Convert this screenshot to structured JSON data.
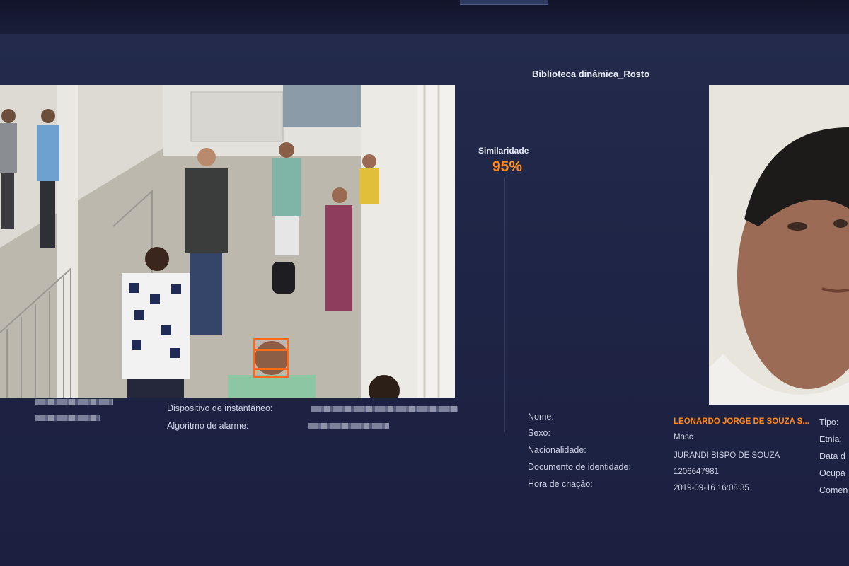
{
  "library": {
    "title": "Biblioteca dinâmica_Rosto"
  },
  "match": {
    "similarity_label": "Similaridade",
    "similarity_value": "95%"
  },
  "snapshot": {
    "device_label": "Dispositivo de instantâneo:",
    "algorithm_label": "Algoritmo de alarme:"
  },
  "person": {
    "labels": {
      "name": "Nome:",
      "sex": "Sexo:",
      "nationality": "Nacionalidade:",
      "id_document": "Documento de identidade:",
      "created": "Hora de criação:"
    },
    "values": {
      "name": "LEONARDO JORGE DE SOUZA S...",
      "sex": "Masc",
      "nationality": "JURANDI BISPO DE SOUZA",
      "id_document": "1206647981",
      "created": "2019-09-16 16:08:35"
    }
  },
  "extra_fields": [
    "Tipo:",
    "Etnia:",
    "Data d",
    "Ocupa",
    "Comen"
  ],
  "colors": {
    "background": "#1e2342",
    "accent": "#ff8a1c",
    "face_box": "#ff6a1a",
    "text": "#cfd3e6"
  }
}
